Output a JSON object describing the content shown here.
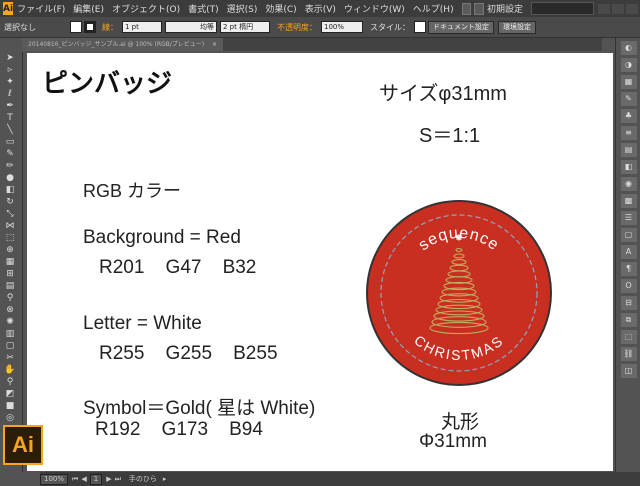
{
  "app": {
    "logo": "Ai",
    "menu": [
      "ファイル(F)",
      "編集(E)",
      "オブジェクト(O)",
      "書式(T)",
      "選択(S)",
      "効果(C)",
      "表示(V)",
      "ウィンドウ(W)",
      "ヘルプ(H)"
    ],
    "workspace": "初期設定",
    "window_controls": [
      "minimize-icon",
      "maximize-icon",
      "close-icon"
    ]
  },
  "control_bar": {
    "selection": "選択なし",
    "stroke_label": "線：",
    "stroke_weight": "1 pt",
    "profile": "均等",
    "brush": "2 pt 楕円",
    "opacity_label": "不透明度：",
    "opacity": "100%",
    "style_label": "スタイル：",
    "doc_settings": "ドキュメント設定",
    "prefs": "環境設定",
    "accent": "#f7a51c"
  },
  "tab": {
    "label": "20140816_ピンバッジ_サンプル.ai @ 100% (RGB/プレビュー)"
  },
  "artboard": {
    "title": "ピンバッジ",
    "size": "サイズφ31mm",
    "scale": "S＝1:1",
    "rgb_heading": "RGB カラー",
    "background_label": "Background = Red",
    "background_values": "R201    G47    B32",
    "letter_label": "Letter = White",
    "letter_values": "R255    G255    B255",
    "symbol_label": "Symbol＝Gold( 星は White)",
    "symbol_values": "R192    G173    B94",
    "badge_shape": "丸形",
    "badge_diameter": "Φ31mm",
    "badge_top_text": "sequence",
    "badge_bottom_text": "CHRISTMAS",
    "colors": {
      "red": "#c92f20",
      "white": "#ffffff",
      "gold": "#c0ad5e"
    }
  },
  "status": {
    "zoom": "100%",
    "page": "1",
    "tool": "手のひら"
  }
}
